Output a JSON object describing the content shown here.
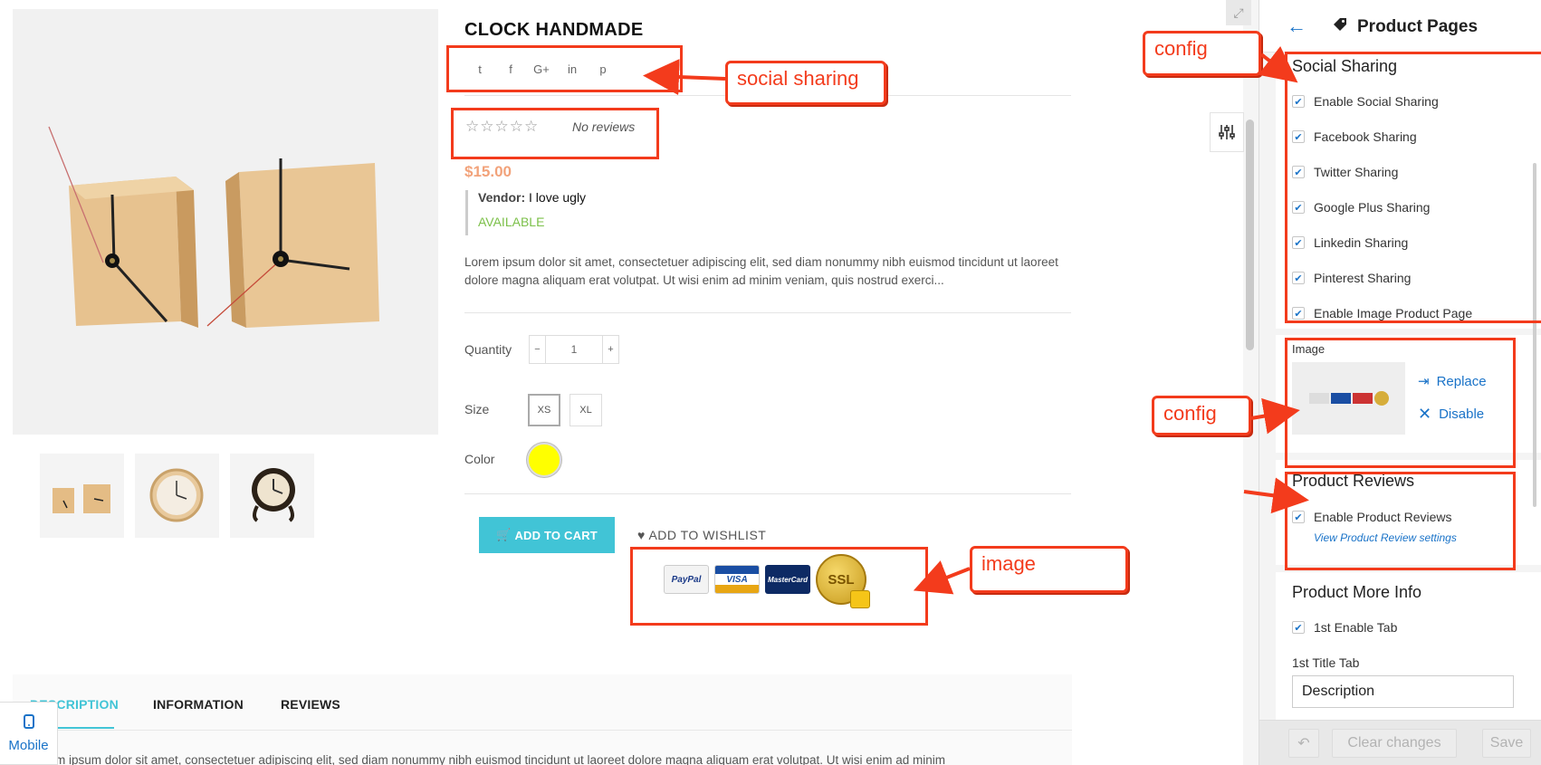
{
  "product": {
    "title": "CLOCK HANDMADE",
    "stars": "☆☆☆☆☆",
    "no_reviews": "No reviews",
    "price": "$15.00",
    "vendor_label": "Vendor:",
    "vendor_name": "I love ugly",
    "availability": "AVAILABLE",
    "description": "Lorem ipsum dolor sit amet, consectetuer adipiscing elit, sed diam nonummy nibh euismod tincidunt ut laoreet dolore magna aliquam erat volutpat. Ut wisi enim ad minim veniam, quis nostrud exerci...",
    "quantity_label": "Quantity",
    "quantity_minus": "−",
    "quantity_value": "1",
    "quantity_plus": "+",
    "size_label": "Size",
    "sizes": [
      "XS",
      "XL"
    ],
    "selected_size": "XS",
    "color_label": "Color",
    "color_value": "#ffff00",
    "add_to_cart": "ADD TO CART",
    "wishlist": "ADD TO WISHLIST",
    "payment_logos": [
      "PayPal",
      "VISA",
      "MasterCard",
      "SSL"
    ]
  },
  "social_icons": [
    "twitter-icon",
    "facebook-icon",
    "google-plus-icon",
    "linkedin-icon",
    "pinterest-icon"
  ],
  "social_glyphs": [
    "t",
    "f",
    "G+",
    "in",
    "p"
  ],
  "tabs": [
    "DESCRIPTION",
    "INFORMATION",
    "REVIEWS"
  ],
  "tab_text": "Lorem ipsum dolor sit amet, consectetuer adipiscing elit, sed diam nonummy nibh euismod tincidunt ut laoreet dolore magna aliquam erat volutpat. Ut wisi enim ad minim",
  "mobile_toggle": "Mobile",
  "annotations": {
    "social_sharing": "social sharing",
    "config_top": "config",
    "config_mid": "config",
    "image": "image"
  },
  "panel": {
    "title": "Product Pages",
    "social_section": "Social Sharing",
    "social_checks": [
      "Enable Social Sharing",
      "Facebook Sharing",
      "Twitter Sharing",
      "Google Plus Sharing",
      "Linkedin Sharing",
      "Pinterest Sharing",
      "Enable Image Product Page"
    ],
    "image_label": "Image",
    "replace": "Replace",
    "disable": "Disable",
    "reviews_section": "Product Reviews",
    "reviews_check": "Enable Product Reviews",
    "reviews_link": "View Product Review settings",
    "more_info_section": "Product More Info",
    "more_info_check": "1st Enable Tab",
    "title_tab_label": "1st Title Tab",
    "title_tab_value": "Description",
    "clear_changes": "Clear changes",
    "save": "Save"
  },
  "colors": {
    "accent": "#41c4d6",
    "annotation": "#f33b1c",
    "link": "#1a73c8",
    "price": "#f2a27a",
    "available": "#7cc04a"
  }
}
